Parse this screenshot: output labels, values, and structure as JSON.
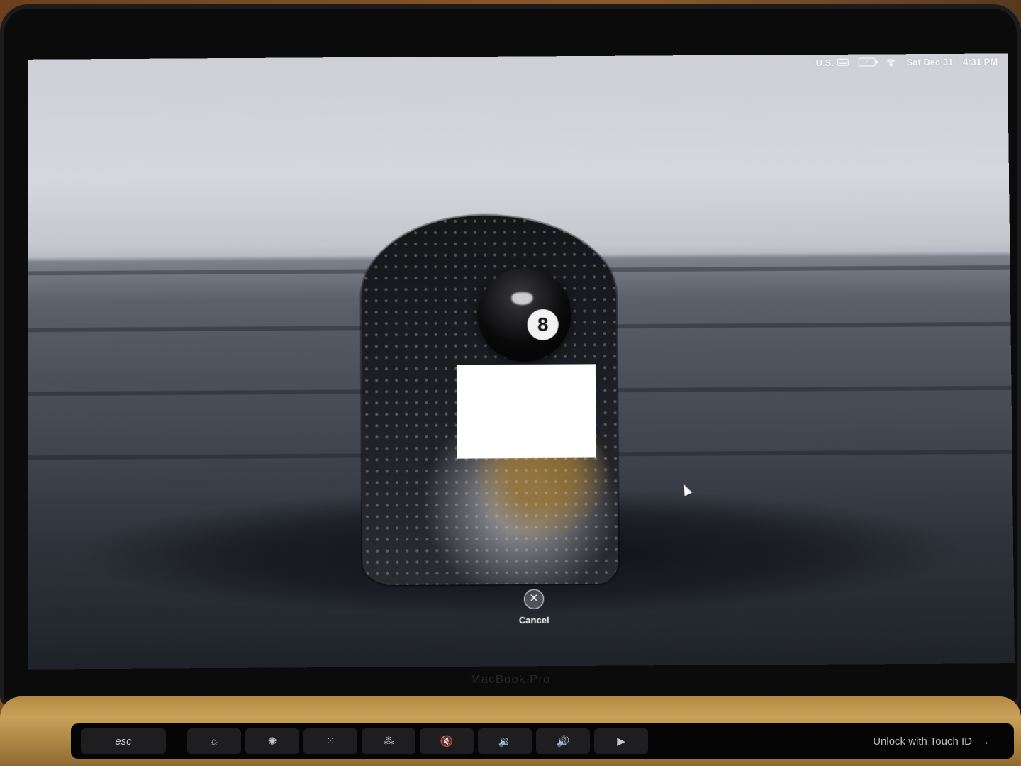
{
  "menubar": {
    "input_source": "U.S.",
    "battery_icon": "battery-charging-icon",
    "wifi_icon": "wifi-icon",
    "date": "Sat Dec 31",
    "time": "4:31 PM"
  },
  "login": {
    "avatar_glyph": "8",
    "cancel_icon_glyph": "✕",
    "cancel_label": "Cancel"
  },
  "device": {
    "brand": "MacBook Pro"
  },
  "touchbar": {
    "esc_label": "esc",
    "keys": [
      {
        "icon": "brightness-down-icon",
        "glyph": "☼"
      },
      {
        "icon": "brightness-up-icon",
        "glyph": "✺"
      },
      {
        "icon": "keyboard-backlight-down-icon",
        "glyph": "⁙"
      },
      {
        "icon": "keyboard-backlight-up-icon",
        "glyph": "⁂"
      },
      {
        "icon": "mute-icon",
        "glyph": "🔇"
      },
      {
        "icon": "volume-down-icon",
        "glyph": "🔉"
      },
      {
        "icon": "volume-up-icon",
        "glyph": "🔊"
      },
      {
        "icon": "play-icon",
        "glyph": "▶"
      }
    ],
    "unlock_label": "Unlock with Touch ID",
    "unlock_arrow": "→"
  }
}
